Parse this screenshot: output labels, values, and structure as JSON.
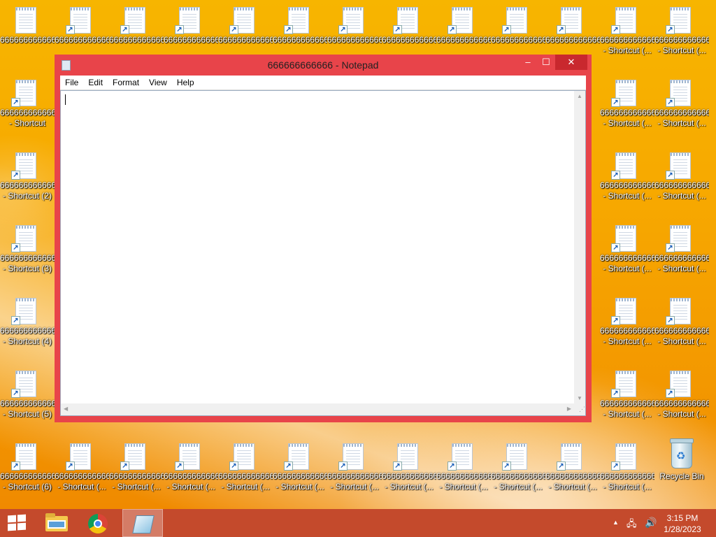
{
  "desktop": {
    "file_name": "666666666666",
    "shortcut_label_truncated": "Shortcut (...",
    "col0_labels": [
      {
        "line1": "666666666666",
        "line2": ""
      },
      {
        "line1": "666666666666",
        "line2": "- Shortcut"
      },
      {
        "line1": "666666666666",
        "line2": "- Shortcut (2)"
      },
      {
        "line1": "666666666666",
        "line2": "- Shortcut (3)"
      },
      {
        "line1": "666666666666",
        "line2": "- Shortcut (4)"
      },
      {
        "line1": "666666666666",
        "line2": "- Shortcut (5)"
      },
      {
        "line1": "666666666666",
        "line2": "- Shortcut (6)"
      }
    ],
    "bottom_row_label": {
      "line1": "666666666666",
      "line2": "- Shortcut (..."
    },
    "right_col_label": {
      "line1": "666666666666",
      "line2": "- Shortcut (..."
    },
    "recycle_bin_label": "Recycle Bin"
  },
  "notepad": {
    "title": "666666666666 - Notepad",
    "menu": [
      "File",
      "Edit",
      "Format",
      "View",
      "Help"
    ],
    "content": "",
    "buttons": {
      "minimize": "‒",
      "maximize": "☐",
      "close": "✕"
    }
  },
  "taskbar": {
    "apps": [
      "start",
      "file-explorer",
      "chrome",
      "notepad"
    ],
    "clock_time": "3:15 PM",
    "clock_date": "1/28/2023"
  },
  "icons": {
    "shortcut_arrow": "↗",
    "tray_chevron": "▲",
    "network": "🖧",
    "volume": "🔊"
  },
  "colors": {
    "window_frame": "#e8444a",
    "taskbar": "#c44a2c",
    "desktop": "#f7a800"
  }
}
